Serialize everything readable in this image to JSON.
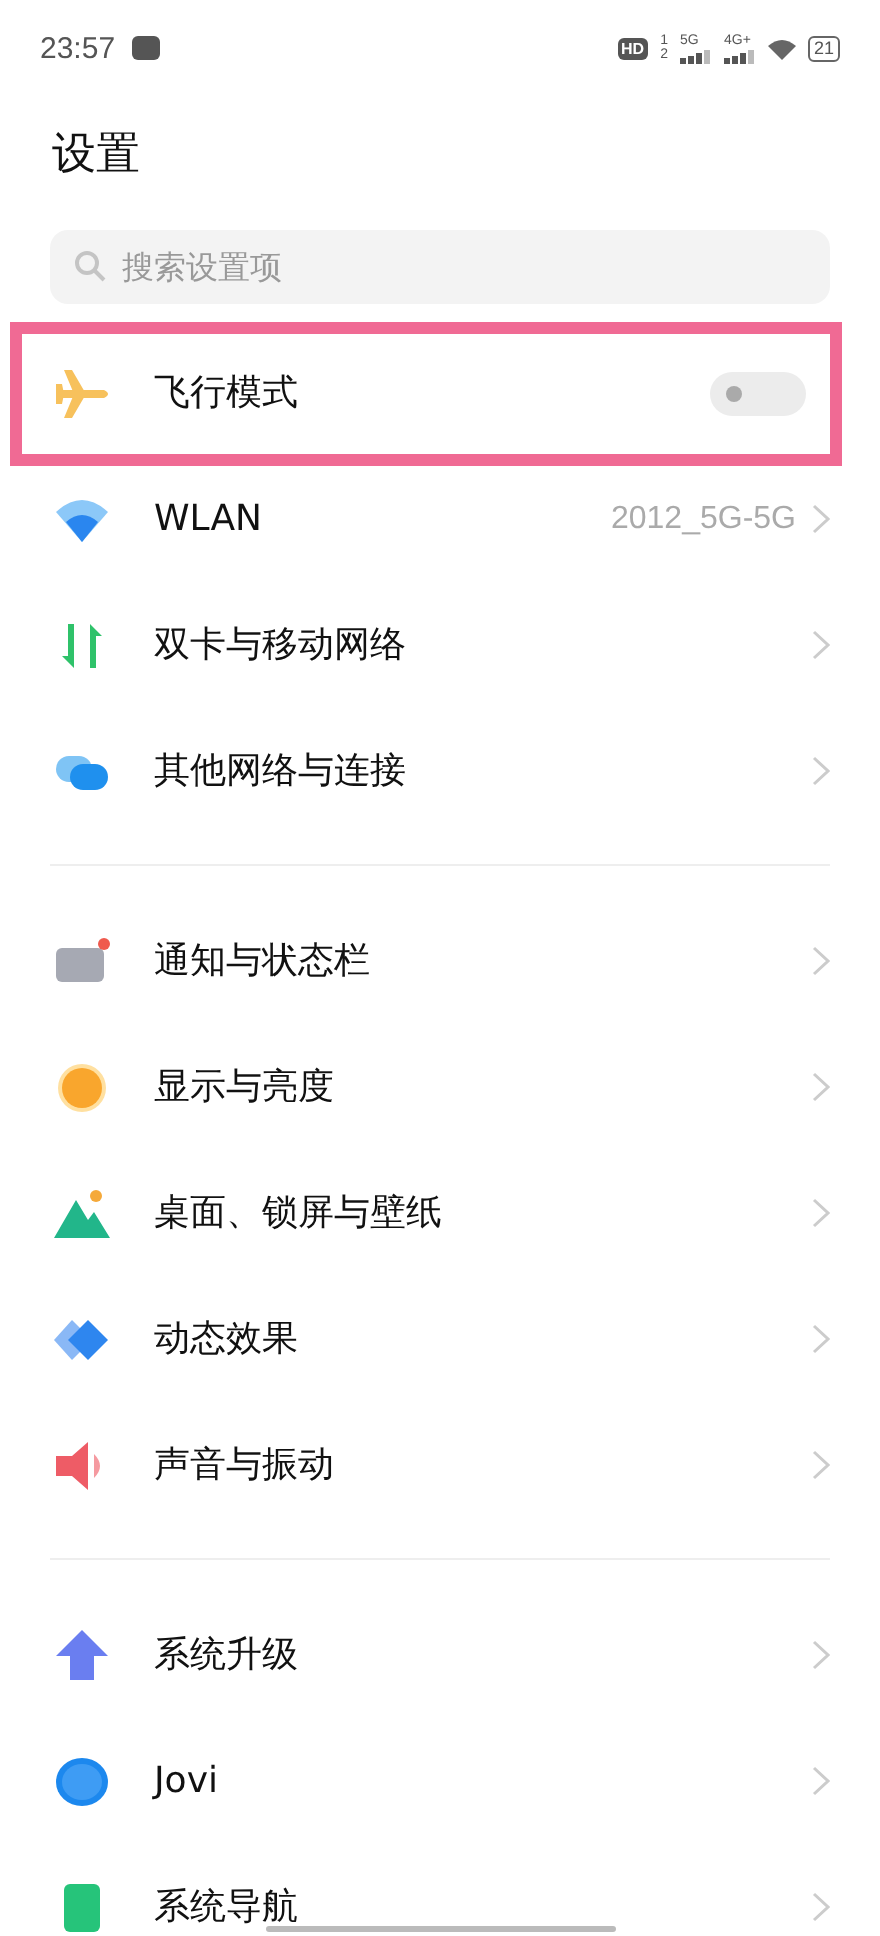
{
  "status_bar": {
    "time": "23:57",
    "hd": "HD",
    "sim_slots": [
      "1",
      "2"
    ],
    "networks": [
      "5G",
      "4G+"
    ],
    "battery": "21"
  },
  "title": "设置",
  "search": {
    "placeholder": "搜索设置项"
  },
  "groups": [
    {
      "items": [
        {
          "kind": "toggle",
          "label": "飞行模式",
          "on": false,
          "highlighted": true
        },
        {
          "kind": "link",
          "label": "WLAN",
          "value": "2012_5G-5G",
          "highlighted": false
        },
        {
          "kind": "link",
          "label": "双卡与移动网络",
          "highlighted": false
        },
        {
          "kind": "link",
          "label": "其他网络与连接",
          "highlighted": false
        }
      ]
    },
    {
      "items": [
        {
          "kind": "link",
          "label": "通知与状态栏",
          "highlighted": false
        },
        {
          "kind": "link",
          "label": "显示与亮度",
          "highlighted": false
        },
        {
          "kind": "link",
          "label": "桌面、锁屏与壁纸",
          "highlighted": false
        },
        {
          "kind": "link",
          "label": "动态效果",
          "highlighted": false
        },
        {
          "kind": "link",
          "label": "声音与振动",
          "highlighted": false
        }
      ]
    },
    {
      "items": [
        {
          "kind": "link",
          "label": "系统升级",
          "highlighted": false
        },
        {
          "kind": "link",
          "label": "Jovi",
          "highlighted": false
        },
        {
          "kind": "link",
          "label": "系统导航",
          "highlighted": false
        }
      ]
    }
  ]
}
